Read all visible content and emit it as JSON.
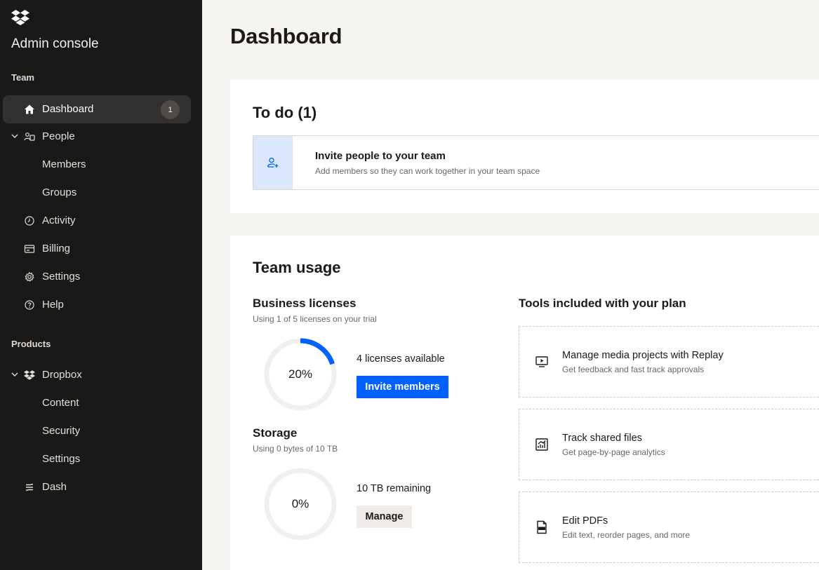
{
  "sidebar": {
    "title": "Admin console",
    "team_section": "Team",
    "products_section": "Products",
    "items": {
      "dashboard": {
        "label": "Dashboard",
        "badge": "1"
      },
      "people": {
        "label": "People"
      },
      "members": {
        "label": "Members"
      },
      "groups": {
        "label": "Groups"
      },
      "activity": {
        "label": "Activity"
      },
      "billing": {
        "label": "Billing"
      },
      "settings": {
        "label": "Settings"
      },
      "help": {
        "label": "Help"
      },
      "dropbox": {
        "label": "Dropbox"
      },
      "content": {
        "label": "Content"
      },
      "security": {
        "label": "Security"
      },
      "dropbox_settings": {
        "label": "Settings"
      },
      "dash": {
        "label": "Dash"
      }
    }
  },
  "main": {
    "page_title": "Dashboard",
    "todo": {
      "title": "To do (1)",
      "item_title": "Invite people to your team",
      "item_subtitle": "Add members so they can work together in your team space"
    },
    "usage": {
      "title": "Team usage",
      "licenses": {
        "heading": "Business licenses",
        "note": "Using 1 of 5 licenses on your trial",
        "percent_label": "20%",
        "fraction": 0.2,
        "available": "4 licenses available",
        "button": "Invite members"
      },
      "storage": {
        "heading": "Storage",
        "note": "Using 0 bytes of 10 TB",
        "percent_label": "0%",
        "fraction": 0,
        "remaining": "10 TB remaining",
        "button": "Manage"
      },
      "tools": {
        "heading": "Tools included with your plan",
        "items": [
          {
            "title": "Manage media projects with Replay",
            "subtitle": "Get feedback and fast track approvals",
            "icon": "replay-icon"
          },
          {
            "title": "Track shared files",
            "subtitle": "Get page-by-page analytics",
            "icon": "analytics-icon"
          },
          {
            "title": "Edit PDFs",
            "subtitle": "Edit text, reorder pages, and more",
            "icon": "pdf-icon"
          }
        ]
      }
    }
  },
  "colors": {
    "accent": "#0061fe",
    "sidebar_bg": "#1a1918",
    "page_bg": "#f7f5f2",
    "todo_icon_bg": "#dbe8fb"
  }
}
